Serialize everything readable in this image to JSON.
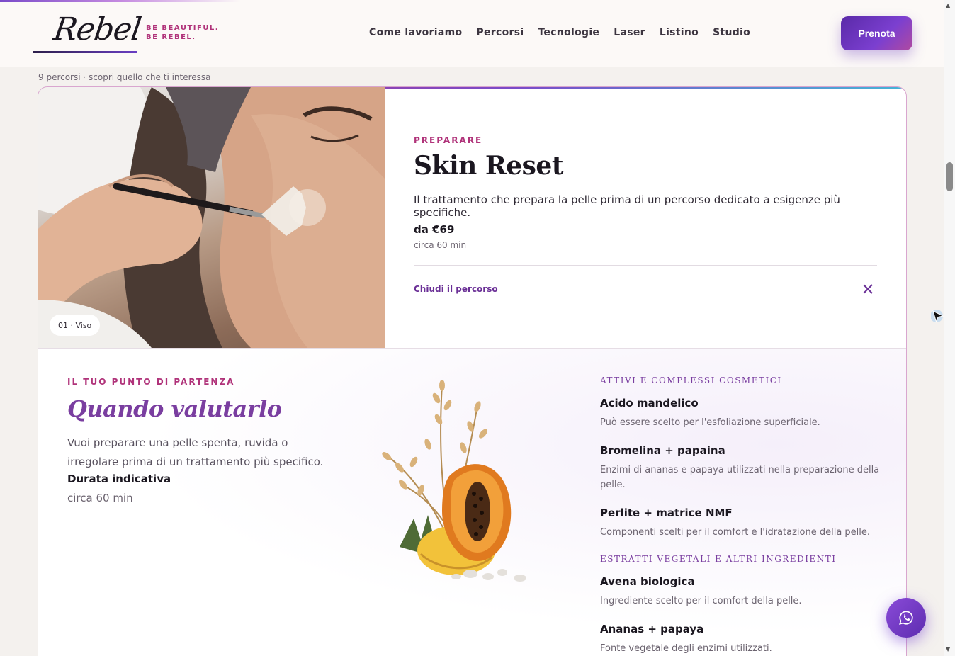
{
  "header": {
    "logo_text": "Rebel",
    "tagline": "BE BEAUTIFUL. BE REBEL.",
    "nav": [
      "Come lavoriamo",
      "Percorsi",
      "Tecnologie",
      "Laser",
      "Listino",
      "Studio"
    ],
    "cta_label": "Prenota"
  },
  "section": {
    "count_line": "9 percorsi · scopri quello che ti interessa"
  },
  "card": {
    "badge": "01 · Viso",
    "eyebrow": "PREPARARE",
    "title": "Skin Reset",
    "description": "Il trattamento che prepara la pelle prima di un percorso dedicato a esigenze più specifiche.",
    "price": "da €69",
    "duration": "circa 60 min",
    "close_label": "Chiudi il percorso"
  },
  "start": {
    "eyebrow": "IL TUO PUNTO DI PARTENZA",
    "title": "Quando valutarlo",
    "text": "Vuoi preparare una pelle spenta, ruvida o irregolare prima di un trattamento più specifico.",
    "duration_label": "Durata indicativa",
    "duration_value": "circa 60 min"
  },
  "ingredients": {
    "groups": [
      {
        "title": "Attivi e complessi cosmetici",
        "items": [
          {
            "name": "Acido mandelico",
            "desc": "Può essere scelto per l'esfoliazione superficiale."
          },
          {
            "name": "Bromelina + papaina",
            "desc": "Enzimi di ananas e papaya utilizzati nella preparazione della pelle."
          },
          {
            "name": "Perlite + matrice NMF",
            "desc": "Componenti scelti per il comfort e l'idratazione della pelle."
          }
        ]
      },
      {
        "title": "Estratti vegetali e altri ingredienti",
        "items": [
          {
            "name": "Avena biologica",
            "desc": "Ingrediente scelto per il comfort della pelle."
          },
          {
            "name": "Ananas + papaya",
            "desc": "Fonte vegetale degli enzimi utilizzati."
          }
        ]
      }
    ]
  },
  "colors": {
    "accent": "#b0337a",
    "brand_purple": "#7a3ea0",
    "cta_gradient_start": "#5a2aa8"
  },
  "icons": {
    "close": "close-icon",
    "whatsapp": "whatsapp-icon",
    "cursor": "cursor-arrow-icon"
  }
}
